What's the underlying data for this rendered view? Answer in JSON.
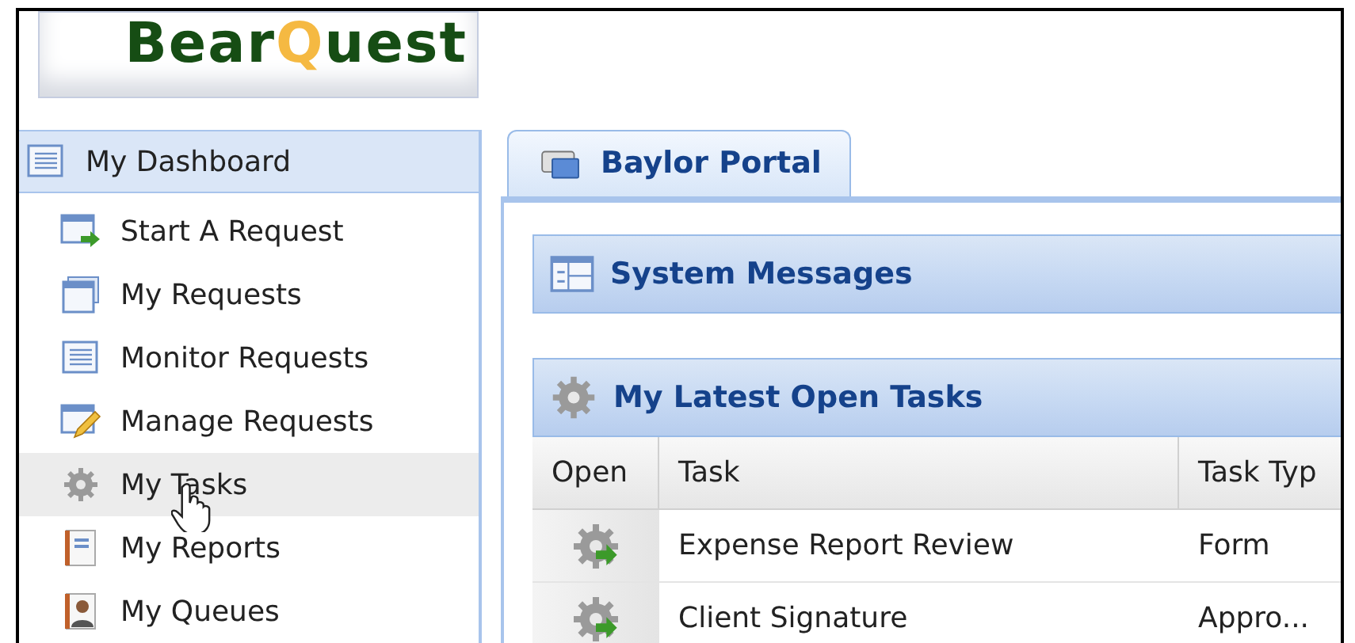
{
  "logo": {
    "parts": [
      {
        "text": "Bear",
        "accent": false
      },
      {
        "text": "Q",
        "accent": true
      },
      {
        "text": "uest",
        "accent": false
      }
    ]
  },
  "sidebar": {
    "title": "My Dashboard",
    "items": [
      {
        "label": "Start A Request",
        "kind": "start",
        "highlighted": false
      },
      {
        "label": "My Requests",
        "kind": "windows",
        "highlighted": false
      },
      {
        "label": "Monitor Requests",
        "kind": "list",
        "highlighted": false
      },
      {
        "label": "Manage Requests",
        "kind": "pencil",
        "highlighted": false
      },
      {
        "label": "My Tasks",
        "kind": "gear",
        "highlighted": true
      },
      {
        "label": "My Reports",
        "kind": "notebook",
        "highlighted": false
      },
      {
        "label": "My Queues",
        "kind": "person",
        "highlighted": false
      }
    ]
  },
  "tabs": [
    {
      "label": "Baylor Portal",
      "selected": true
    }
  ],
  "panels": [
    {
      "title": "System Messages",
      "kind": "messages"
    },
    {
      "title": "My Latest Open Tasks",
      "kind": "tasks"
    }
  ],
  "table": {
    "columns": [
      "Open",
      "Task",
      "Task Typ"
    ],
    "rows": [
      {
        "task": "Expense Report Review",
        "task_type": "Form"
      },
      {
        "task": "Client Signature",
        "task_type": "Appro..."
      }
    ]
  }
}
